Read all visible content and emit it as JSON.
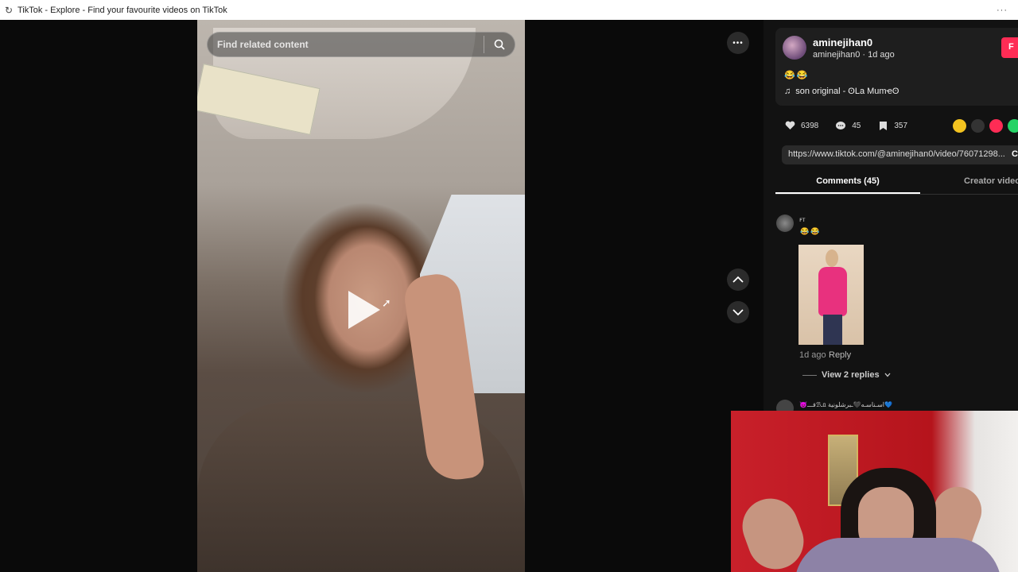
{
  "window": {
    "title": "TikTok - Explore - Find your favourite videos on TikTok",
    "menu": "···"
  },
  "search": {
    "placeholder": "Find related content"
  },
  "video": {
    "more": "•••"
  },
  "author": {
    "username": "aminejihan0",
    "handle_time": "aminejihan0 · 1d ago",
    "follow_label": "F",
    "caption_emoji": "😂😂",
    "music": "son original - ʘLa Mumҽʘ"
  },
  "stats": {
    "likes": "6398",
    "comments": "45",
    "saves": "357"
  },
  "share_colors": [
    "#f3c320",
    "#333333",
    "#fe2c55",
    "#25d366"
  ],
  "link": {
    "url": "https://www.tiktok.com/@aminejihan0/video/76071298...",
    "copy": "C"
  },
  "tabs": {
    "comments": "Comments (45)",
    "creator": "Creator videos"
  },
  "comment1": {
    "name": "ꜰᴛ",
    "emoji": "😂😂",
    "time": "1d ago",
    "reply": "Reply",
    "view_replies": "View 2 replies"
  },
  "comment2": {
    "name": "😈فـــℬـᥲ اسـناسـه🖤ـبرشلونية💙"
  }
}
